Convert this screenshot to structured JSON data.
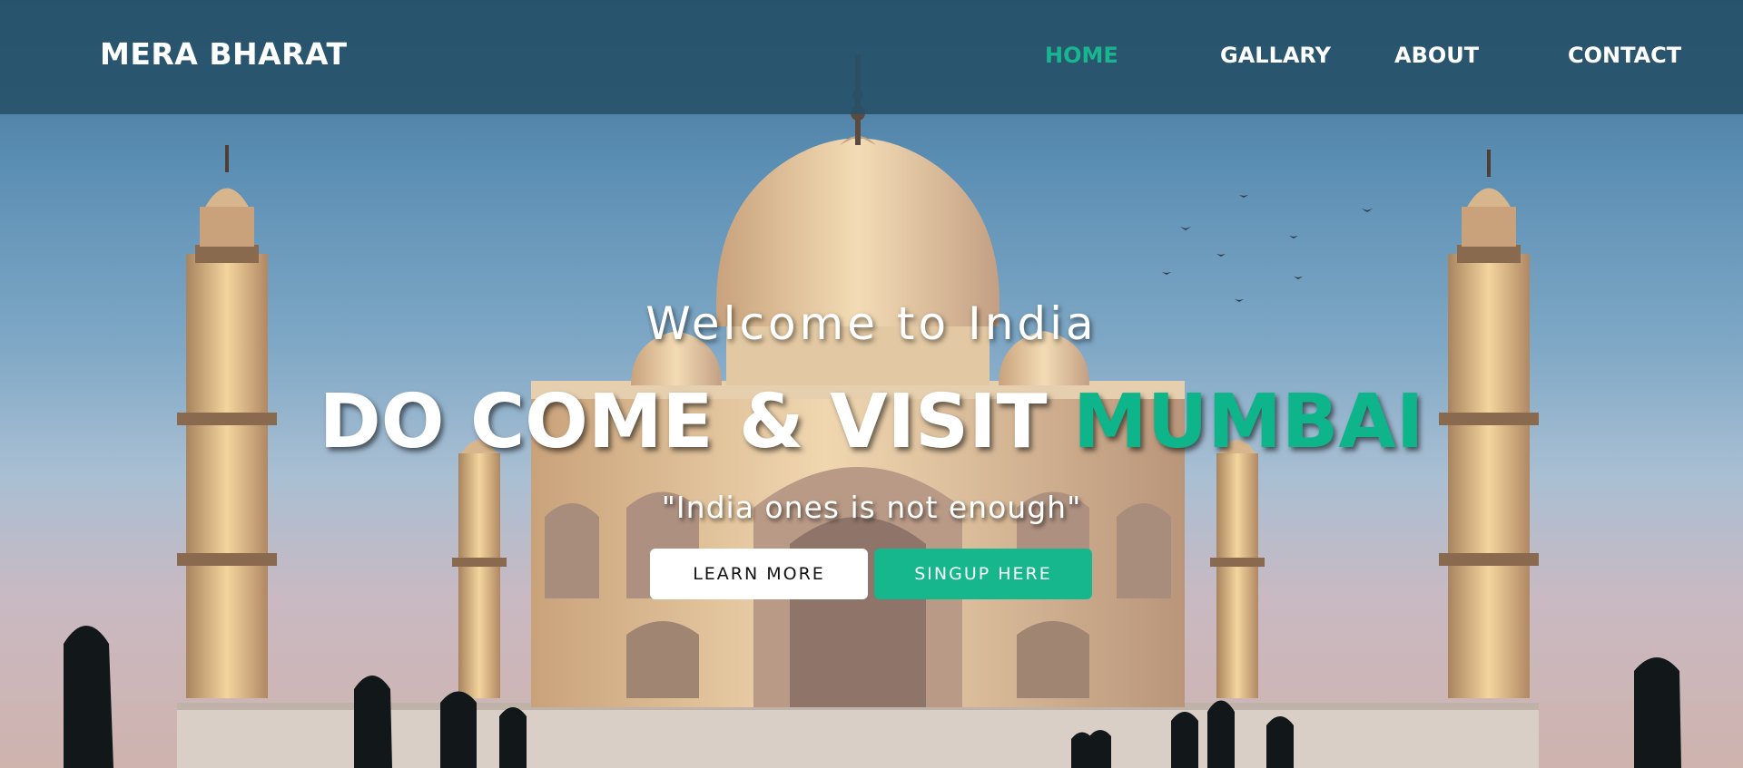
{
  "navbar": {
    "brand": "MERA BHARAT",
    "links": [
      {
        "label": "HOME",
        "active": true
      },
      {
        "label": "GALLARY",
        "active": false
      },
      {
        "label": "ABOUT",
        "active": false
      },
      {
        "label": "CONTACT",
        "active": false
      }
    ]
  },
  "hero": {
    "welcome": "Welcome to India",
    "headline_prefix": "DO COME & VISIT ",
    "headline_accent": "MUMBAI",
    "tagline": "\"India ones is not enough\"",
    "buttons": {
      "learn_more": "LEARN MORE",
      "signup": "SINGUP HERE"
    },
    "background_image": "taj-mahal-photo"
  },
  "colors": {
    "accent": "#16b78c",
    "navbar_bg": "#265068",
    "text": "#ffffff"
  }
}
